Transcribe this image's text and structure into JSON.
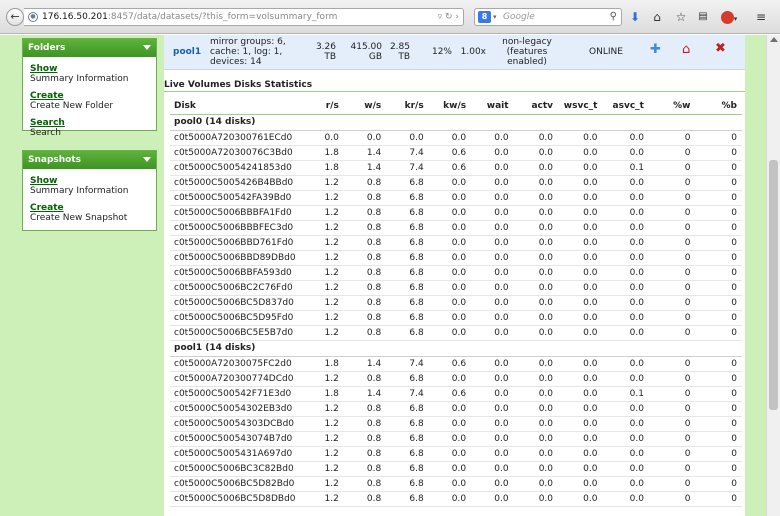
{
  "browser": {
    "url_host": "176.16.50.201",
    "url_rest": ":8457/data/datasets/?this_form=volsummary_form",
    "search_placeholder": "Google"
  },
  "sidebar": {
    "folders": {
      "title": "Folders",
      "items": [
        {
          "link": "Show",
          "desc": "Summary Information"
        },
        {
          "link": "Create",
          "desc": "Create New Folder"
        },
        {
          "link": "Search",
          "desc": "Search"
        }
      ]
    },
    "snapshots": {
      "title": "Snapshots",
      "items": [
        {
          "link": "Show",
          "desc": "Summary Information"
        },
        {
          "link": "Create",
          "desc": "Create New Snapshot"
        }
      ]
    }
  },
  "pool_row": {
    "name": "pool1",
    "config_line1": "mirror groups: 6,",
    "config_line2": "cache: 1, log: 1,",
    "config_line3": "devices: 14",
    "size_v": "3.26",
    "size_u": "TB",
    "used_v": "415.00",
    "used_u": "GB",
    "free_v": "2.85",
    "free_u": "TB",
    "pct": "12%",
    "ratio": "1.00x",
    "feat_line1": "non-legacy",
    "feat_line2": "(features",
    "feat_line3": "enabled)",
    "status": "ONLINE"
  },
  "section_title": "Live Volumes Disks Statistics",
  "columns": [
    "Disk",
    "r/s",
    "w/s",
    "kr/s",
    "kw/s",
    "wait",
    "actv",
    "wsvc_t",
    "asvc_t",
    "%w",
    "%b"
  ],
  "groups": [
    {
      "name": "pool0 (14 disks)",
      "rows": [
        [
          "c0t5000A720300761ECd0",
          "0.0",
          "0.0",
          "0.0",
          "0.0",
          "0.0",
          "0.0",
          "0.0",
          "0.0",
          "0",
          "0"
        ],
        [
          "c0t5000A72030076C3Bd0",
          "1.8",
          "1.4",
          "7.4",
          "0.6",
          "0.0",
          "0.0",
          "0.0",
          "0.0",
          "0",
          "0"
        ],
        [
          "c0t5000C50054241853d0",
          "1.8",
          "1.4",
          "7.4",
          "0.6",
          "0.0",
          "0.0",
          "0.0",
          "0.1",
          "0",
          "0"
        ],
        [
          "c0t5000C5005426B4BBd0",
          "1.2",
          "0.8",
          "6.8",
          "0.0",
          "0.0",
          "0.0",
          "0.0",
          "0.0",
          "0",
          "0"
        ],
        [
          "c0t5000C500542FA39Bd0",
          "1.2",
          "0.8",
          "6.8",
          "0.0",
          "0.0",
          "0.0",
          "0.0",
          "0.0",
          "0",
          "0"
        ],
        [
          "c0t5000C5006BBBFA1Fd0",
          "1.2",
          "0.8",
          "6.8",
          "0.0",
          "0.0",
          "0.0",
          "0.0",
          "0.0",
          "0",
          "0"
        ],
        [
          "c0t5000C5006BBBFEC3d0",
          "1.2",
          "0.8",
          "6.8",
          "0.0",
          "0.0",
          "0.0",
          "0.0",
          "0.0",
          "0",
          "0"
        ],
        [
          "c0t5000C5006BBD761Fd0",
          "1.2",
          "0.8",
          "6.8",
          "0.0",
          "0.0",
          "0.0",
          "0.0",
          "0.0",
          "0",
          "0"
        ],
        [
          "c0t5000C5006BBD89DBd0",
          "1.2",
          "0.8",
          "6.8",
          "0.0",
          "0.0",
          "0.0",
          "0.0",
          "0.0",
          "0",
          "0"
        ],
        [
          "c0t5000C5006BBFA593d0",
          "1.2",
          "0.8",
          "6.8",
          "0.0",
          "0.0",
          "0.0",
          "0.0",
          "0.0",
          "0",
          "0"
        ],
        [
          "c0t5000C5006BC2C76Fd0",
          "1.2",
          "0.8",
          "6.8",
          "0.0",
          "0.0",
          "0.0",
          "0.0",
          "0.0",
          "0",
          "0"
        ],
        [
          "c0t5000C5006BC5D837d0",
          "1.2",
          "0.8",
          "6.8",
          "0.0",
          "0.0",
          "0.0",
          "0.0",
          "0.0",
          "0",
          "0"
        ],
        [
          "c0t5000C5006BC5D95Fd0",
          "1.2",
          "0.8",
          "6.8",
          "0.0",
          "0.0",
          "0.0",
          "0.0",
          "0.0",
          "0",
          "0"
        ],
        [
          "c0t5000C5006BC5E5B7d0",
          "1.2",
          "0.8",
          "6.8",
          "0.0",
          "0.0",
          "0.0",
          "0.0",
          "0.0",
          "0",
          "0"
        ]
      ]
    },
    {
      "name": "pool1 (14 disks)",
      "rows": [
        [
          "c0t5000A72030075FC2d0",
          "1.8",
          "1.4",
          "7.4",
          "0.6",
          "0.0",
          "0.0",
          "0.0",
          "0.0",
          "0",
          "0"
        ],
        [
          "c0t5000A720300774DCd0",
          "1.2",
          "0.8",
          "6.8",
          "0.0",
          "0.0",
          "0.0",
          "0.0",
          "0.0",
          "0",
          "0"
        ],
        [
          "c0t5000C500542F71E3d0",
          "1.8",
          "1.4",
          "7.4",
          "0.6",
          "0.0",
          "0.0",
          "0.0",
          "0.1",
          "0",
          "0"
        ],
        [
          "c0t5000C50054302EB3d0",
          "1.2",
          "0.8",
          "6.8",
          "0.0",
          "0.0",
          "0.0",
          "0.0",
          "0.0",
          "0",
          "0"
        ],
        [
          "c0t5000C50054303DCBd0",
          "1.2",
          "0.8",
          "6.8",
          "0.0",
          "0.0",
          "0.0",
          "0.0",
          "0.0",
          "0",
          "0"
        ],
        [
          "c0t5000C500543074B7d0",
          "1.2",
          "0.8",
          "6.8",
          "0.0",
          "0.0",
          "0.0",
          "0.0",
          "0.0",
          "0",
          "0"
        ],
        [
          "c0t5000C5005431A697d0",
          "1.2",
          "0.8",
          "6.8",
          "0.0",
          "0.0",
          "0.0",
          "0.0",
          "0.0",
          "0",
          "0"
        ],
        [
          "c0t5000C5006BC3C82Bd0",
          "1.2",
          "0.8",
          "6.8",
          "0.0",
          "0.0",
          "0.0",
          "0.0",
          "0.0",
          "0",
          "0"
        ],
        [
          "c0t5000C5006BC5D82Bd0",
          "1.2",
          "0.8",
          "6.8",
          "0.0",
          "0.0",
          "0.0",
          "0.0",
          "0.0",
          "0",
          "0"
        ],
        [
          "c0t5000C5006BC5D8DBd0",
          "1.2",
          "0.8",
          "6.8",
          "0.0",
          "0.0",
          "0.0",
          "0.0",
          "0.0",
          "0",
          "0"
        ]
      ]
    }
  ],
  "colors": {
    "sidebar_bg": "#cdf0b8",
    "panel_header": "#4ca52e",
    "link": "#006400",
    "pool_row_bg": "#e4eefb"
  }
}
